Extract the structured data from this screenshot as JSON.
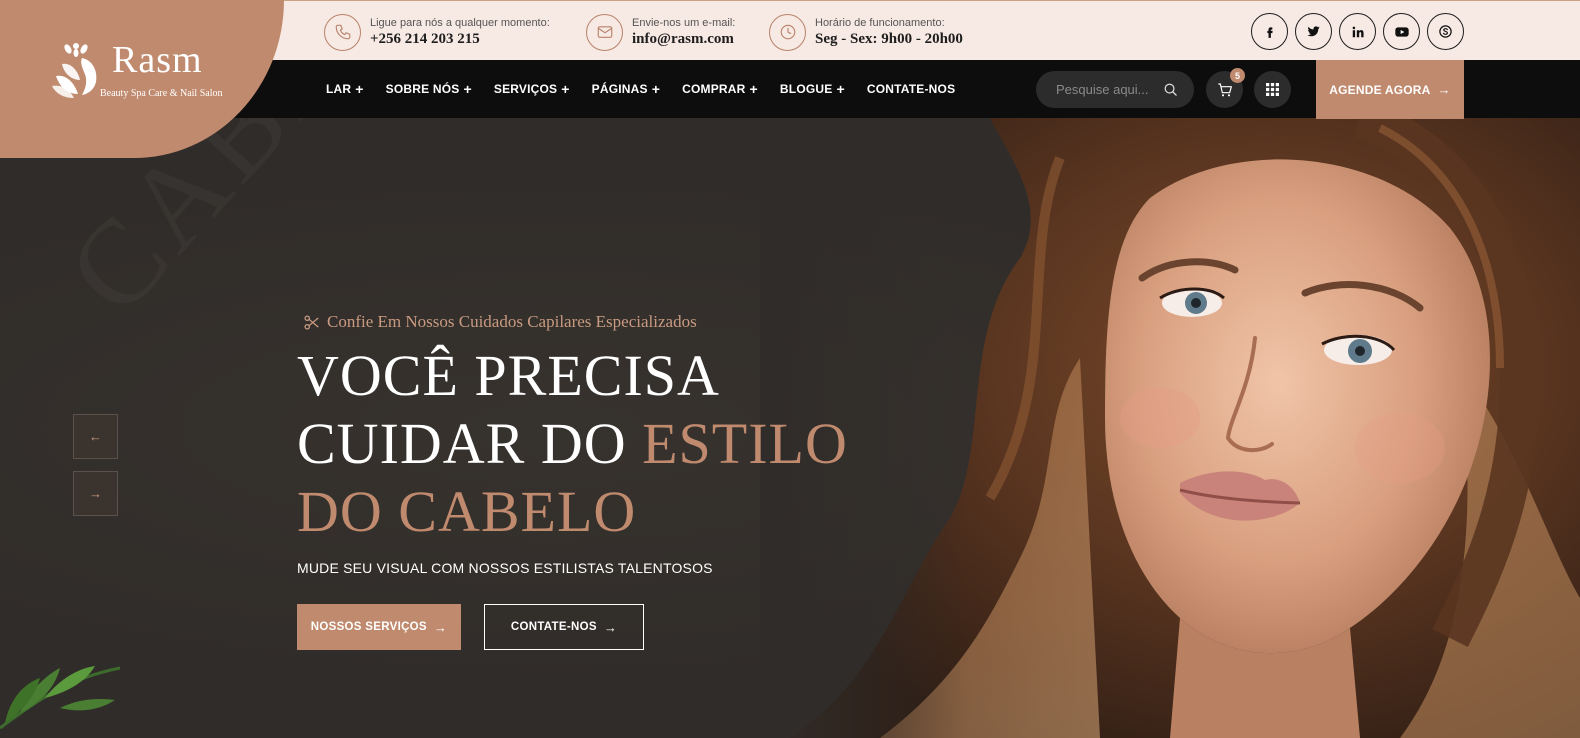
{
  "brand": {
    "name": "Rasm",
    "tagline": "Beauty Spa Care & Nail Salon",
    "color": "#c08a6e"
  },
  "topbar": {
    "phone": {
      "label": "Ligue para nós a qualquer momento:",
      "value": "+256 214 203 215",
      "icon": "phone-icon"
    },
    "email": {
      "label": "Envie-nos um e-mail:",
      "value": "info@rasm.com",
      "icon": "envelope-icon"
    },
    "hours": {
      "label": "Horário de funcionamento:",
      "value": "Seg - Sex: 9h00 - 20h00",
      "icon": "clock-icon"
    },
    "socials": [
      {
        "name": "facebook",
        "glyph": "f"
      },
      {
        "name": "twitter",
        "glyph": "t"
      },
      {
        "name": "linkedin",
        "glyph": "in"
      },
      {
        "name": "youtube",
        "glyph": "▶"
      },
      {
        "name": "skype",
        "glyph": "S"
      }
    ]
  },
  "nav": {
    "items": [
      {
        "label": "LAR",
        "plus": "+"
      },
      {
        "label": "SOBRE NÓS",
        "plus": "+"
      },
      {
        "label": "SERVIÇOS",
        "plus": "+"
      },
      {
        "label": "PÁGINAS",
        "plus": "+"
      },
      {
        "label": "COMPRAR",
        "plus": "+"
      },
      {
        "label": "BLOGUE",
        "plus": "+"
      },
      {
        "label": "CONTATE-NOS",
        "plus": ""
      }
    ],
    "search_placeholder": "Pesquise aqui...",
    "cart_count": "5",
    "book_label": "AGENDE AGORA",
    "arrow": "→"
  },
  "hero": {
    "subtitle": "Confie Em Nossos Cuidados Capilares Especializados",
    "headline_line1": "VOCÊ PRECISA",
    "headline_line2_a": "CUIDAR DO ",
    "headline_line2_b": "ESTILO",
    "headline_line3": "DO CABELO",
    "tagline": "MUDE SEU VISUAL COM NOSSOS ESTILISTAS TALENTOSOS",
    "watermark": "CABELO SALÃO",
    "primary_button": "NOSSOS SERVIÇOS",
    "secondary_button": "CONTATE-NOS",
    "prev": "←",
    "next": "→"
  }
}
